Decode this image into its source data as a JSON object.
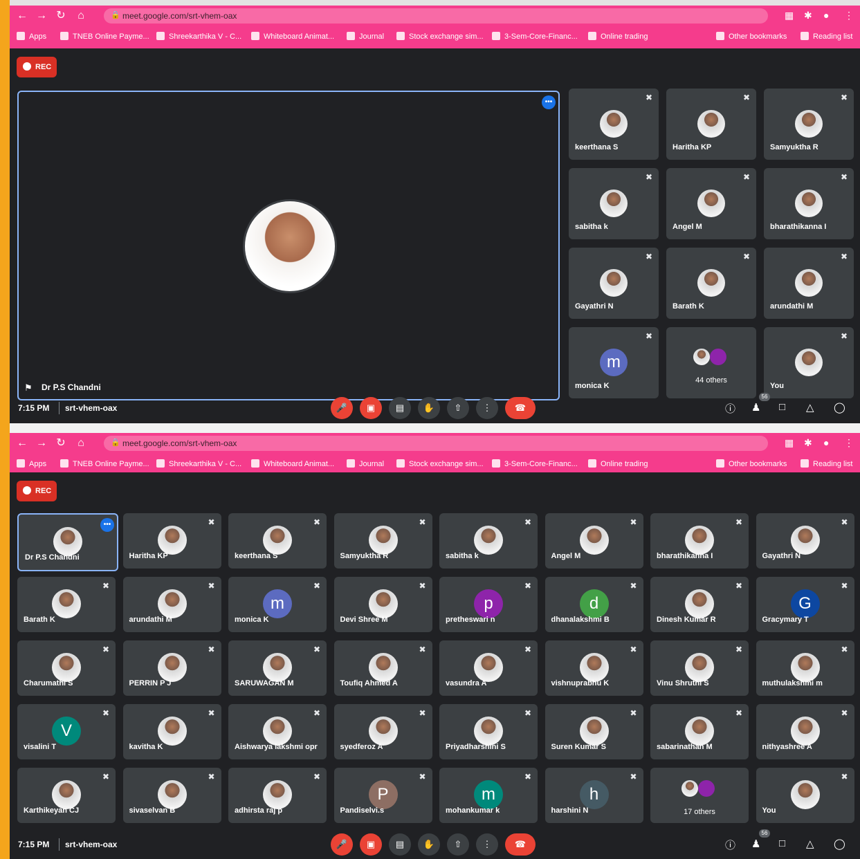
{
  "browser": {
    "url": "meet.google.com/srt-vhem-oax",
    "bookmarks": [
      "Apps",
      "TNEB Online Payme...",
      "Shreekarthika V - C...",
      "Whiteboard Animat...",
      "Journal",
      "Stock exchange sim...",
      "3-Sem-Core-Financ...",
      "Online trading"
    ],
    "right_bookmarks": [
      "Other bookmarks",
      "Reading list"
    ]
  },
  "meet": {
    "rec_label": "REC",
    "time": "7:15 PM",
    "code": "srt-vhem-oax",
    "participant_badge": "56",
    "speaker_name": "Dr P.S Chandni"
  },
  "screen1": {
    "tiles": [
      {
        "name": "keerthana S",
        "avatar": "photo"
      },
      {
        "name": "Haritha KP",
        "avatar": "photo"
      },
      {
        "name": "Samyuktha R",
        "avatar": "photo"
      },
      {
        "name": "sabitha k",
        "avatar": "photo"
      },
      {
        "name": "Angel M",
        "avatar": "photo"
      },
      {
        "name": "bharathikanna I",
        "avatar": "photo"
      },
      {
        "name": "Gayathri N",
        "avatar": "photo"
      },
      {
        "name": "Barath K",
        "avatar": "photo"
      },
      {
        "name": "arundathi M",
        "avatar": "photo"
      },
      {
        "name": "monica K",
        "avatar": "letter",
        "letter": "m",
        "color": "#5c6bc0"
      },
      {
        "name": "44 others",
        "avatar": "others"
      },
      {
        "name": "You",
        "avatar": "photo"
      }
    ]
  },
  "screen2": {
    "tiles": [
      {
        "name": "Dr P.S Chandni",
        "avatar": "photo",
        "active": true
      },
      {
        "name": "Haritha KP",
        "avatar": "photo"
      },
      {
        "name": "keerthana S",
        "avatar": "photo"
      },
      {
        "name": "Samyuktha R",
        "avatar": "photo"
      },
      {
        "name": "sabitha k",
        "avatar": "photo"
      },
      {
        "name": "Angel M",
        "avatar": "photo"
      },
      {
        "name": "bharathikanna I",
        "avatar": "photo"
      },
      {
        "name": "Gayathri N",
        "avatar": "photo"
      },
      {
        "name": "Barath K",
        "avatar": "photo"
      },
      {
        "name": "arundathi M",
        "avatar": "photo"
      },
      {
        "name": "monica K",
        "avatar": "letter",
        "letter": "m",
        "color": "#5c6bc0"
      },
      {
        "name": "Devi Shree M",
        "avatar": "photo"
      },
      {
        "name": "pretheswari n",
        "avatar": "letter",
        "letter": "p",
        "color": "#8e24aa"
      },
      {
        "name": "dhanalakshmi B",
        "avatar": "letter",
        "letter": "d",
        "color": "#43a047"
      },
      {
        "name": "Dinesh Kumar R",
        "avatar": "photo"
      },
      {
        "name": "Gracymary T",
        "avatar": "letter",
        "letter": "G",
        "color": "#0d47a1"
      },
      {
        "name": "Charumathi S",
        "avatar": "photo"
      },
      {
        "name": "PERRIN P J",
        "avatar": "photo"
      },
      {
        "name": "SARUWAGAN M",
        "avatar": "photo"
      },
      {
        "name": "Toufiq Ahmed A",
        "avatar": "photo"
      },
      {
        "name": "vasundra A",
        "avatar": "photo"
      },
      {
        "name": "vishnuprabhu K",
        "avatar": "photo"
      },
      {
        "name": "Vinu Shruthi S",
        "avatar": "photo"
      },
      {
        "name": "muthulakshmi m",
        "avatar": "photo"
      },
      {
        "name": "visalini T",
        "avatar": "letter",
        "letter": "V",
        "color": "#00897b"
      },
      {
        "name": "kavitha K",
        "avatar": "photo"
      },
      {
        "name": "Aishwarya lakshmi opr",
        "avatar": "photo"
      },
      {
        "name": "syedferoz A",
        "avatar": "photo"
      },
      {
        "name": "Priyadharshini S",
        "avatar": "photo"
      },
      {
        "name": "Suren Kumar S",
        "avatar": "photo"
      },
      {
        "name": "sabarinathan M",
        "avatar": "photo"
      },
      {
        "name": "nithyashree A",
        "avatar": "photo"
      },
      {
        "name": "Karthikeyan CJ",
        "avatar": "photo"
      },
      {
        "name": "sivaselvan B",
        "avatar": "photo"
      },
      {
        "name": "adhirsta raj p",
        "avatar": "photo"
      },
      {
        "name": "Pandiselvi.s",
        "avatar": "letter",
        "letter": "P",
        "color": "#8d6e63"
      },
      {
        "name": "mohankumar k",
        "avatar": "letter",
        "letter": "m",
        "color": "#00897b"
      },
      {
        "name": "harshini N",
        "avatar": "letter",
        "letter": "h",
        "color": "#455a64"
      },
      {
        "name": "17 others",
        "avatar": "others"
      },
      {
        "name": "You",
        "avatar": "photo"
      }
    ]
  },
  "icons": {
    "back": "back-arrow-icon",
    "forward": "forward-arrow-icon",
    "reload": "reload-icon",
    "home": "home-icon",
    "mic_off": "mic-off-icon",
    "cam_off": "camera-off-icon",
    "captions": "captions-icon",
    "hand": "raise-hand-icon",
    "present": "present-icon",
    "more": "more-icon",
    "hangup": "hangup-icon",
    "info": "info-icon",
    "people": "people-icon",
    "chat": "chat-icon",
    "activities": "activities-icon",
    "host": "host-controls-icon"
  }
}
